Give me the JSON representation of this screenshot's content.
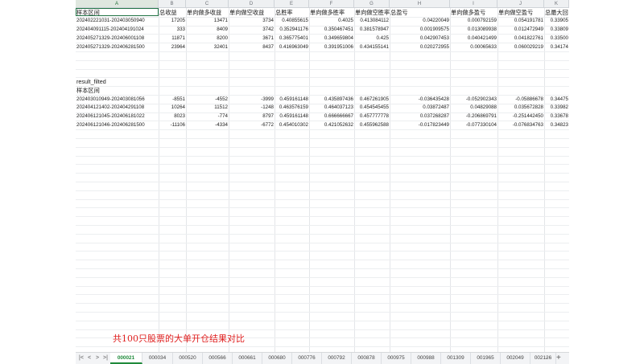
{
  "columns": [
    "A",
    "B",
    "C",
    "D",
    "E",
    "F",
    "G",
    "H",
    "I",
    "J",
    "K"
  ],
  "header_row": [
    "样本区间",
    "总收益",
    "单向做多收益",
    "单向做空收益",
    "总胜率",
    "单向做多胜率",
    "单向做空胜率",
    "总盈亏",
    "单向做多盈亏",
    "单向做空盈亏",
    "总最大回"
  ],
  "rows1": [
    [
      "202402221031-202403050940",
      "17205",
      "13471",
      "3734",
      "0.40855615",
      "0.4025",
      "0.413084112",
      "0.04220049",
      "0.000792159",
      "0.054191781",
      "0.33905"
    ],
    [
      "202404091115-202404191024",
      "333",
      "8409",
      "3742",
      "0.352941176",
      "0.350467451",
      "0.381578947",
      "0.001909575",
      "0.013089938",
      "0.012472949",
      "0.33809"
    ],
    [
      "202405271329-202406001108",
      "11871",
      "8200",
      "3671",
      "0.365775401",
      "0.349659804",
      "0.425",
      "0.042907453",
      "0.040421499",
      "0.041822761",
      "0.33500"
    ],
    [
      "202405271329-202406281500",
      "23964",
      "32401",
      "8437",
      "0.416963049",
      "0.391951006",
      "0.434155141",
      "0.020272955",
      "0.00065633",
      "0.060029219",
      "0.34174"
    ]
  ],
  "section_label": "result_filted",
  "section_header": "样本区间",
  "rows2": [
    [
      "202403010949-202403081056",
      "-8551",
      "-4552",
      "-3999",
      "0.459161148",
      "0.435897436",
      "0.467261905",
      "-0.036435428",
      "-0.052902343",
      "-0.05886678",
      "0.34475"
    ],
    [
      "202404121402-202404291108",
      "10264",
      "11512",
      "-1248",
      "0.463576159",
      "0.464037123",
      "0.454545455",
      "0.03872487",
      "0.04829088",
      "0.035672828",
      "0.33982"
    ],
    [
      "202406121045-202406181022",
      "8023",
      "-774",
      "8797",
      "0.459161148",
      "0.666666667",
      "0.457777778",
      "0.037268287",
      "-0.206869791",
      "-0.251442450",
      "0.33678"
    ],
    [
      "202406121046-202406281500",
      "-11106",
      "-4334",
      "-6772",
      "0.454010302",
      "0.421052632",
      "0.455962588",
      "-0.017823449",
      "-0.077330104",
      "-0.076834763",
      "0.34823"
    ]
  ],
  "annotation": "共100只股票的大单开仓结果对比",
  "tabs": [
    "000021",
    "000034",
    "000520",
    "000566",
    "000661",
    "000680",
    "000776",
    "000792",
    "000878",
    "000975",
    "000988",
    "001309",
    "001965",
    "002049",
    "002126"
  ],
  "active_tab": 0,
  "nav": {
    "first": "|<",
    "prev": "<",
    "next": ">",
    "last": ">|"
  },
  "more_label": "···",
  "add_label": "+"
}
